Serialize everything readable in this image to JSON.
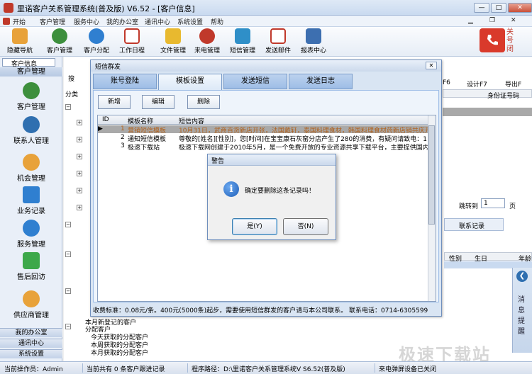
{
  "window": {
    "title": "里诺客户关系管理系统(普及版) V6.52 - [客户信息]",
    "min": "—",
    "max": "□",
    "close": "✕"
  },
  "menu": [
    "开始",
    "客户管理",
    "服务中心",
    "我的办公室",
    "通讯中心",
    "系统设置",
    "帮助"
  ],
  "toolbar": [
    {
      "label": "隐藏导航",
      "color": "#e8a23a"
    },
    {
      "label": "客户管理",
      "color": "#3d8f3d"
    },
    {
      "label": "客户分配",
      "color": "#2f7fd0"
    },
    {
      "label": "工作日程",
      "color": "#c0392b"
    },
    {
      "label": "文件管理",
      "color": "#e8b92f"
    },
    {
      "label": "来电管理",
      "color": "#c0392b"
    },
    {
      "label": "短信管理",
      "color": "#2f8fc8"
    },
    {
      "label": "发送邮件",
      "color": "#c0392b"
    },
    {
      "label": "报表中心",
      "color": "#3d6fb0"
    }
  ],
  "phone_panel": {
    "text": "关 号 闭"
  },
  "left_nav": {
    "header": "客户信息",
    "sub": "客户管理",
    "items": [
      {
        "label": "客户管理",
        "color": "#3d8f3d"
      },
      {
        "label": "联系人管理",
        "color": "#2f6fb0"
      },
      {
        "label": "机会管理",
        "color": "#e8a23a"
      },
      {
        "label": "业务记录",
        "color": "#2f7fd0"
      },
      {
        "label": "服务管理",
        "color": "#2f7fd0"
      },
      {
        "label": "售后回访",
        "color": "#3da84a"
      },
      {
        "label": "供应商管理",
        "color": "#e8a23a"
      }
    ],
    "bottom": [
      "我的办公室",
      "通讯中心",
      "系统设置"
    ]
  },
  "background": {
    "search_label": "搜",
    "class_label": "分类",
    "f6_label": "F6",
    "design": "设计F7",
    "export": "导出F",
    "id_col": "身份证号码",
    "jump_label": "跳转到",
    "jump_value": "1",
    "page_label": "页",
    "contact_tab": "联系记录",
    "col_gender": "性别",
    "col_birthday": "生日",
    "col_age": "年龄",
    "tree_items": [
      "分配客户",
      "今天获取的分配客户",
      "本周获取的分配客户",
      "本月获取的分配客户",
      "本月新登记的客户"
    ],
    "message_label": "消息提醒"
  },
  "dialog": {
    "title": "短信群发",
    "close": "✕",
    "tabs": [
      "账号登陆",
      "模板设置",
      "发送短信",
      "发送日志"
    ],
    "active_tab": 1,
    "buttons": [
      "新增",
      "编辑",
      "删除"
    ],
    "grid": {
      "headers": [
        "ID",
        "模板名称",
        "短信内容"
      ],
      "rows": [
        {
          "id": "1",
          "name": "营销短信模板",
          "content": "10月31日，武商百货新店开张，法国戴轩，泰国料理食材，韩国料理食材药新店销共庆开张",
          "selected": true
        },
        {
          "id": "2",
          "name": "通知短信模板",
          "content": "尊敬的[姓名][性别]，您[时间]在宝宝康石灰窑分店产生了280的消费，有疑问请致电：1",
          "selected": false
        },
        {
          "id": "3",
          "name": "极速下载站",
          "content": "极速下载网创建于2010年5月，是一个免费开放的专业资源共享下载平台，主要提供国内外",
          "selected": false
        }
      ]
    },
    "note": "收费标准：0.08元/条。400元(5000条)起步，需要使用短信群发的客户请与本公司联系。     联系电话：0714-6305599"
  },
  "alert": {
    "title": "警告",
    "icon": "i",
    "message": "确定要删除这条记录吗！",
    "yes": "是(Y)",
    "no": "否(N)"
  },
  "status": {
    "operator": "当前操作员：Admin",
    "summary": "当前共有 0 条客户跟进记录",
    "path": "程序路径：D:\\里诺客户关系管理系统V S6.52(普及版)",
    "popup": "来电弹屏设备已关闭"
  },
  "watermark": "极速下载站"
}
